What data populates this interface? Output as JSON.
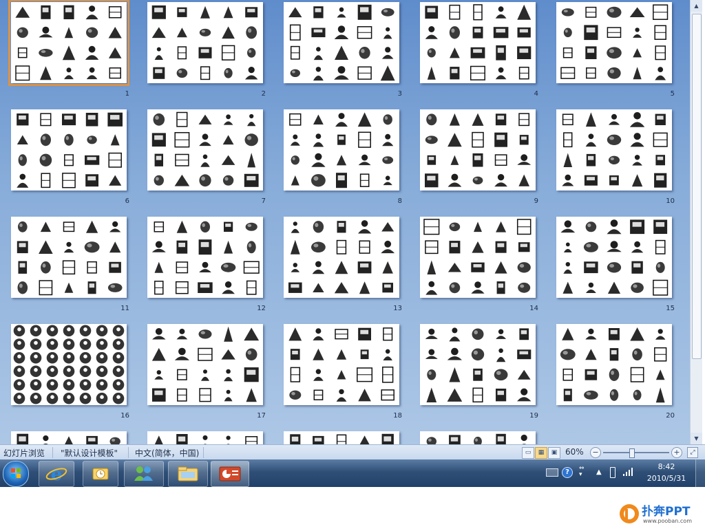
{
  "slides": [
    {
      "number": "1",
      "icon": "clipart-people-icon"
    },
    {
      "number": "2",
      "icon": "speech-bubbles-icon"
    },
    {
      "number": "3",
      "icon": "office-items-icon"
    },
    {
      "number": "4",
      "icon": "education-icon"
    },
    {
      "number": "5",
      "icon": "office-objects-icon"
    },
    {
      "number": "6",
      "icon": "office-workers-icon"
    },
    {
      "number": "7",
      "icon": "business-people-icon"
    },
    {
      "number": "8",
      "icon": "crowd-silhouettes-icon"
    },
    {
      "number": "9",
      "icon": "people-silhouettes-icon"
    },
    {
      "number": "10",
      "icon": "clocks-icon"
    },
    {
      "number": "11",
      "icon": "money-icon"
    },
    {
      "number": "12",
      "icon": "office-equipment-icon"
    },
    {
      "number": "13",
      "icon": "desk-tools-icon"
    },
    {
      "number": "14",
      "icon": "awards-icon"
    },
    {
      "number": "15",
      "icon": "arrows-symbols-icon"
    },
    {
      "number": "16",
      "icon": "signs-icon"
    },
    {
      "number": "17",
      "icon": "computers-icon"
    },
    {
      "number": "18",
      "icon": "media-devices-icon"
    },
    {
      "number": "19",
      "icon": "hands-tools-icon"
    },
    {
      "number": "20",
      "icon": "vehicles-icon"
    },
    {
      "number": "",
      "icon": "partial-slide-icon"
    },
    {
      "number": "",
      "icon": "partial-slide-icon"
    },
    {
      "number": "",
      "icon": "partial-slide-icon"
    },
    {
      "number": "",
      "icon": "partial-slide-icon"
    }
  ],
  "status_bar": {
    "view_name": "幻灯片浏览",
    "template": "\"默认设计模板\"",
    "language": "中文(简体，中国)",
    "zoom": "60%",
    "zoom_level": 0.6
  },
  "taskbar": {
    "apps": [
      "start-orb-icon",
      "internet-explorer-icon",
      "outlook-icon",
      "messenger-icon",
      "explorer-icon",
      "powerpoint-icon"
    ],
    "time": "8:42",
    "date": "2010/5/31"
  },
  "brand": {
    "name": "pooban",
    "title": "扑奔PPT",
    "url": "www.pooban.com"
  },
  "colors": {
    "accent": "#d9944b",
    "workspace": "#7aa0d3"
  }
}
